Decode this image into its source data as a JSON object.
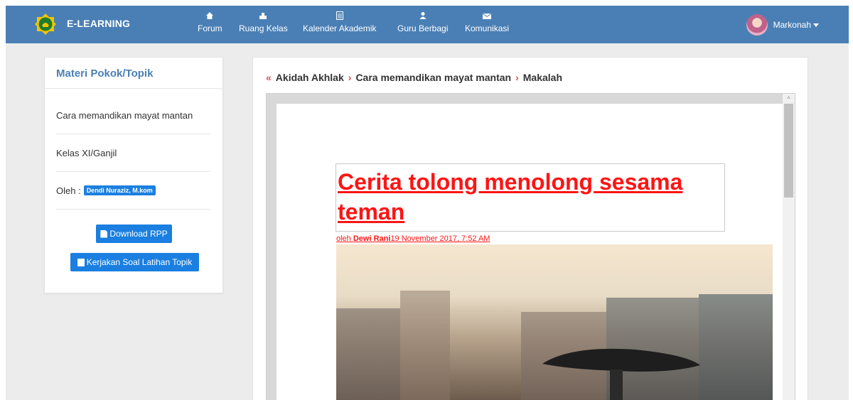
{
  "navbar": {
    "brand": "E-LEARNING",
    "items": [
      {
        "label": "Forum",
        "icon": "home-icon"
      },
      {
        "label": "Ruang Kelas",
        "icon": "classroom-icon"
      },
      {
        "label": "Kalender Akademik",
        "icon": "calendar-icon"
      },
      {
        "label": "Guru Berbagi",
        "icon": "users-icon"
      },
      {
        "label": "Komunikasi",
        "icon": "envelope-icon"
      }
    ],
    "user": "Markonah"
  },
  "sidebar": {
    "title": "Materi Pokok/Topik",
    "topic": "Cara memandikan mayat mantan",
    "class_info": "Kelas XI/Ganjil",
    "author_label": "Oleh :",
    "author_name": "Dendi Nuraziz, M.kom",
    "download_label": "Download RPP",
    "exercise_label": "Kerjakan Soal Latihan Topik"
  },
  "breadcrumb": {
    "items": [
      "Akidah Akhlak",
      "Cara memandikan mayat mantan",
      "Makalah"
    ]
  },
  "document": {
    "title": "Cerita tolong menolong sesama teman",
    "byline_prefix": "oleh ",
    "byline_author": "Dewi Rani",
    "byline_date": "19 November 2017, 7:52 AM"
  },
  "colors": {
    "navbar": "#4a7fb5",
    "button": "#1a7fe0",
    "title": "#ff1414",
    "breadcrumb_separator": "#d9534f"
  }
}
